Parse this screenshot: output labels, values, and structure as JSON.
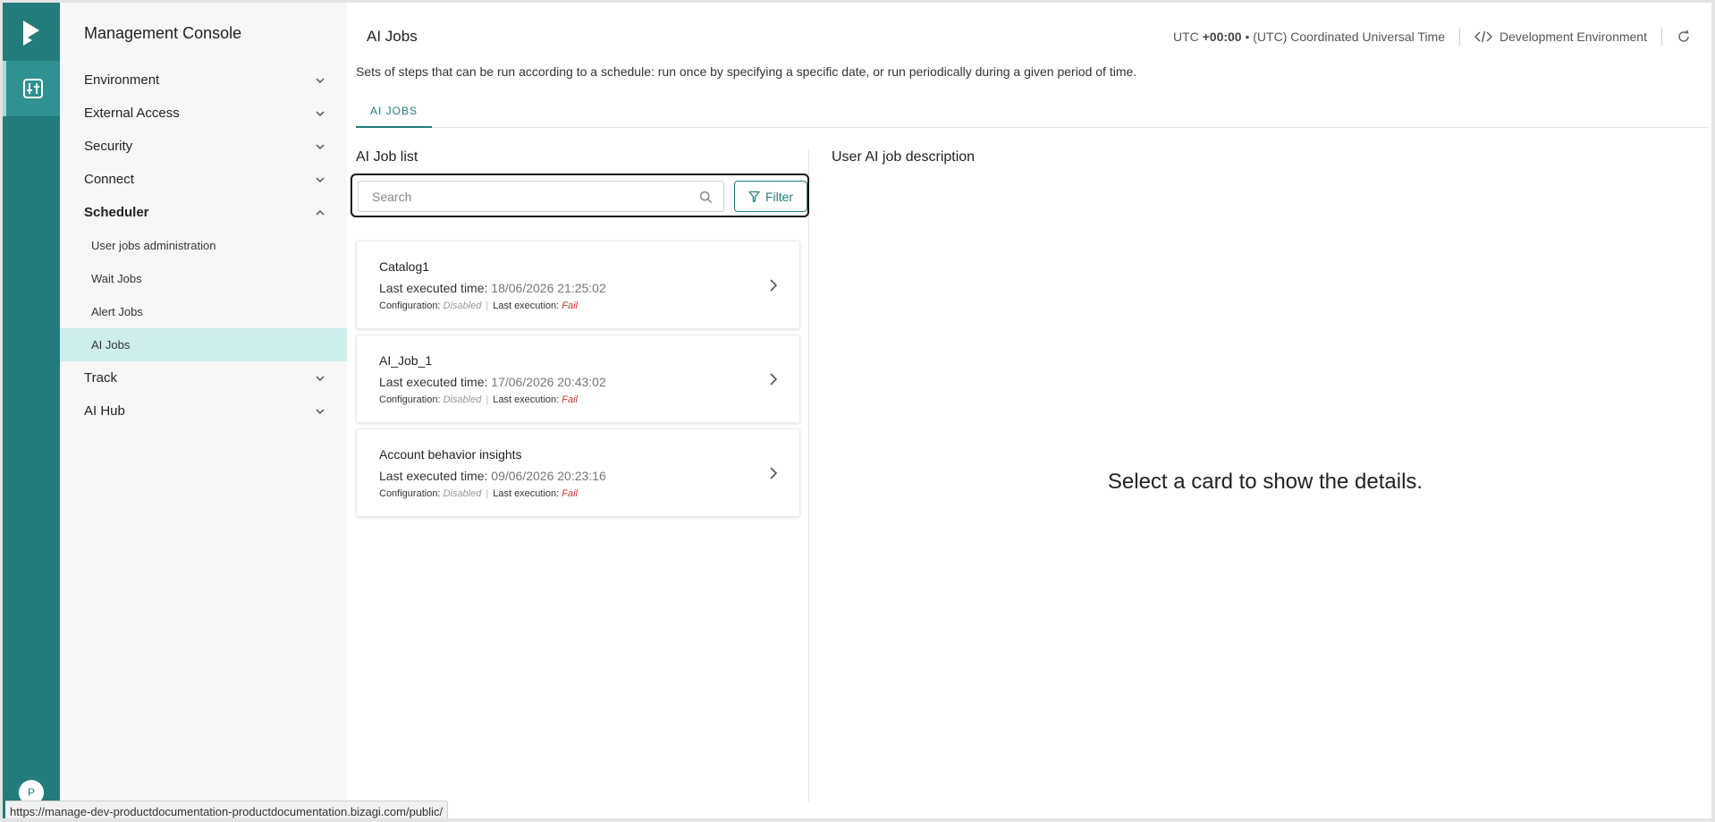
{
  "app": {
    "name": "Management Console",
    "user_initial": "P"
  },
  "sidebar": {
    "items": [
      {
        "label": "Environment",
        "state": "collapsed"
      },
      {
        "label": "External Access",
        "state": "collapsed"
      },
      {
        "label": "Security",
        "state": "collapsed"
      },
      {
        "label": "Connect",
        "state": "collapsed"
      },
      {
        "label": "Scheduler",
        "state": "expanded",
        "children": [
          {
            "label": "User jobs administration"
          },
          {
            "label": "Wait Jobs"
          },
          {
            "label": "Alert Jobs"
          },
          {
            "label": "AI Jobs",
            "active": true
          }
        ]
      },
      {
        "label": "Track",
        "state": "collapsed"
      },
      {
        "label": "AI Hub",
        "state": "collapsed"
      }
    ]
  },
  "header": {
    "title": "AI Jobs",
    "timezone_prefix": "UTC ",
    "timezone_offset": "+00:00",
    "timezone_name": " • (UTC) Coordinated Universal Time",
    "environment": "Development Environment",
    "description": "Sets of steps that can be run according to a schedule: run once by specifying a specific date, or run periodically during a given period of time."
  },
  "tabs": [
    {
      "label": "AI JOBS",
      "active": true
    }
  ],
  "list": {
    "title": "AI Job list",
    "search_placeholder": "Search",
    "filter_label": "Filter",
    "time_label": "Last executed time: ",
    "config_label": "Configuration: ",
    "exec_label": "Last execution: ",
    "cards": [
      {
        "name": "Catalog1",
        "time": "18/06/2026 21:25:02",
        "configuration": "Disabled",
        "last_execution": "Fail"
      },
      {
        "name": "AI_Job_1",
        "time": "17/06/2026 20:43:02",
        "configuration": "Disabled",
        "last_execution": "Fail"
      },
      {
        "name": "Account behavior insights",
        "time": "09/06/2026 20:23:16",
        "configuration": "Disabled",
        "last_execution": "Fail"
      }
    ]
  },
  "detail": {
    "title": "User AI job description",
    "empty_message": "Select a card to show the details."
  },
  "status_url": "https://manage-dev-productdocumentation-productdocumentation.bizagi.com/public/",
  "colors": {
    "brand": "#227c7c",
    "active_item": "#cdeeed",
    "fail": "#d32f2f"
  }
}
